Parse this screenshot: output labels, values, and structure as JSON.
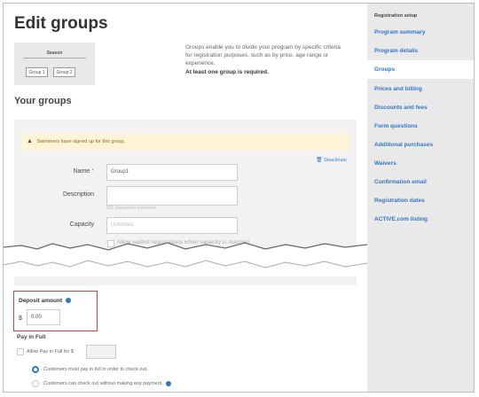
{
  "page": {
    "title": "Edit groups",
    "description": "Groups enable you to divide your program by specific criteria for registration purposes, such as by price, age range or experience.",
    "requirement": "At least one group is required.",
    "your_groups": "Your groups"
  },
  "preview": {
    "season": "Season",
    "groups": [
      "Group 1",
      "Group 2"
    ]
  },
  "group_card": {
    "warning": "Swimmers have signed up for this group.",
    "deactivate": "Deactivate",
    "name_label": "Name",
    "name_required": "*",
    "name_value": "Group1",
    "description_label": "Description",
    "description_hint": "255 characters maximum",
    "capacity_label": "Capacity",
    "capacity_placeholder": "Unlimited",
    "waitlist_label": "Allow waitlist registrations when capacity is reached"
  },
  "deposit": {
    "label": "Deposit amount",
    "currency": "$",
    "value": "0.00"
  },
  "pay_in_full": {
    "title": "Pay in Full",
    "allow_label": "Allow Pay in Full for $",
    "options": [
      {
        "label": "Customers must pay in full in order to check out.",
        "selected": true
      },
      {
        "label": "Customers can check out without making any payment.",
        "selected": false
      }
    ]
  },
  "sidebar": {
    "heading": "Registration setup",
    "items": [
      {
        "label": "Program summary",
        "active": false
      },
      {
        "label": "Program details",
        "active": false
      },
      {
        "label": "Groups",
        "active": true
      },
      {
        "label": "Prices and billing",
        "active": false
      },
      {
        "label": "Discounts and fees",
        "active": false
      },
      {
        "label": "Form questions",
        "active": false
      },
      {
        "label": "Additional purchases",
        "active": false
      },
      {
        "label": "Waivers",
        "active": false
      },
      {
        "label": "Confirmation email",
        "active": false
      },
      {
        "label": "Registration dates",
        "active": false
      },
      {
        "label": "ACTIVE.com listing",
        "active": false
      }
    ]
  },
  "colors": {
    "accent": "#2f76c9",
    "highlight": "#e23b3b",
    "warning_bg": "#fff4d6"
  }
}
